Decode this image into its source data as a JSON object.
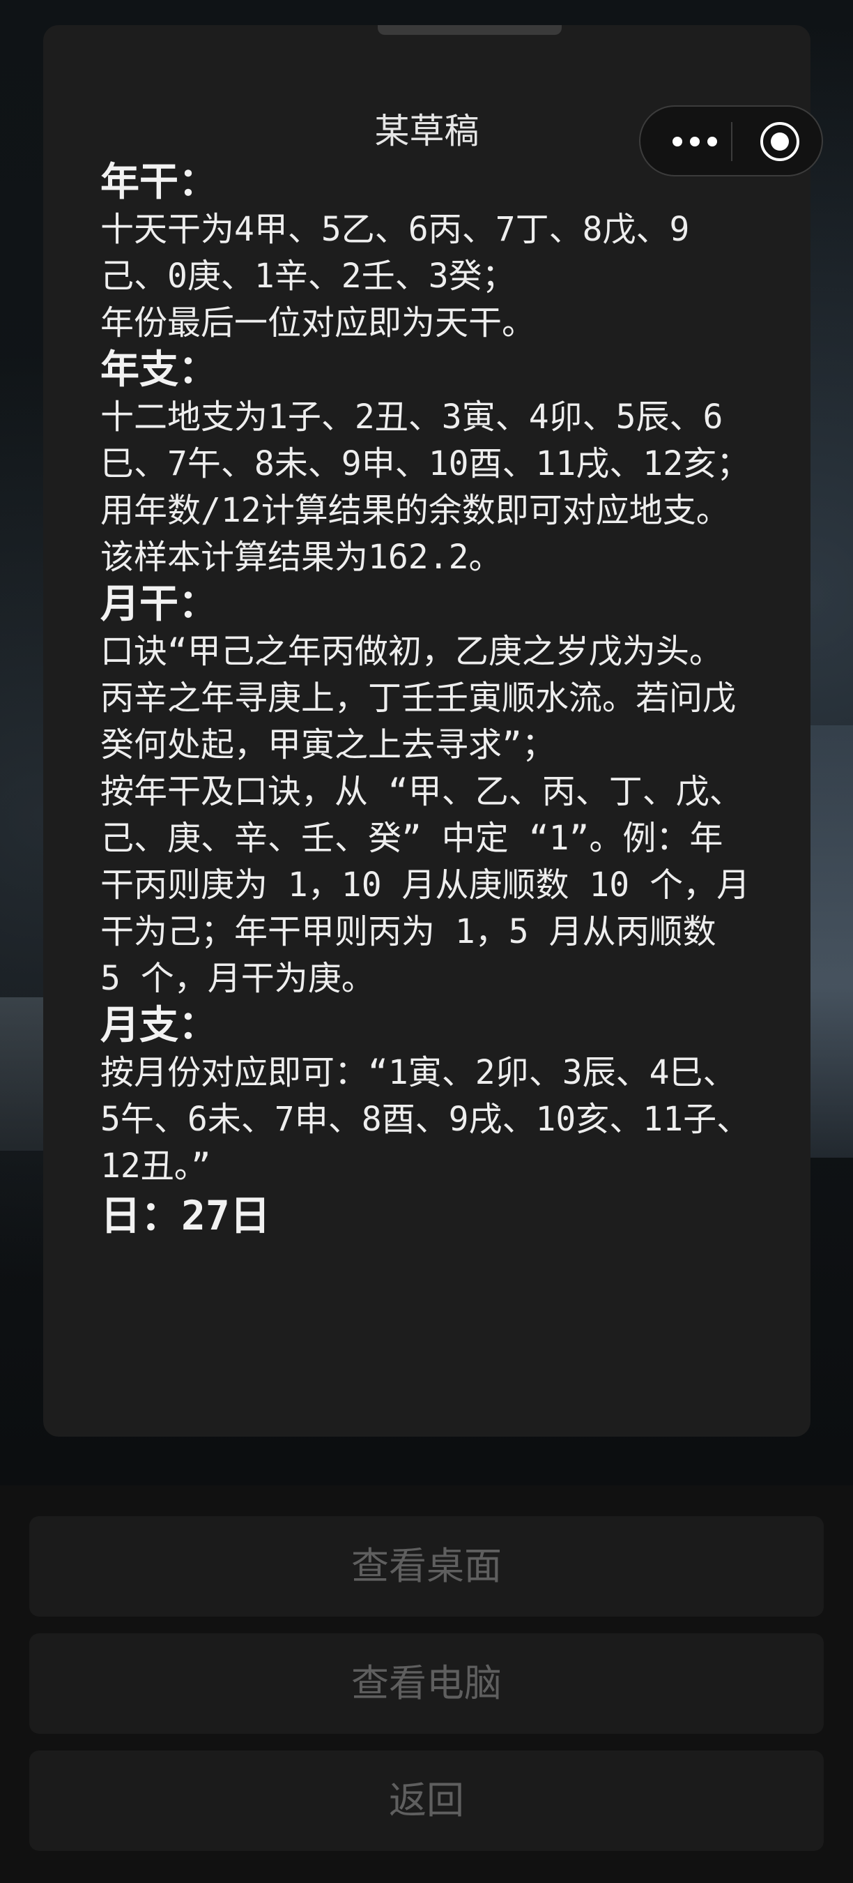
{
  "card": {
    "title": "某草稿",
    "sections": [
      {
        "heading": "年干：",
        "paragraphs": [
          "十天干为4甲、5乙、6丙、7丁、8戊、9己、0庚、1辛、2壬、3癸；",
          "年份最后一位对应即为天干。"
        ]
      },
      {
        "heading": "年支：",
        "paragraphs": [
          "十二地支为1子、2丑、3寅、4卯、5辰、6巳、7午、8未、9申、10酉、11戌、12亥；",
          "用年数/12计算结果的余数即可对应地支。该样本计算结果为162.2。"
        ]
      },
      {
        "heading": "月干：",
        "paragraphs": [
          "口诀“甲己之年丙做初，乙庚之岁戊为头。丙辛之年寻庚上，丁壬壬寅顺水流。若问戊癸何处起，甲寅之上去寻求”；",
          "按年干及口诀，从 “甲、乙、丙、丁、戊、己、庚、辛、壬、癸” 中定 “1”。例：年干丙则庚为 1，10 月从庚顺数 10 个，月干为己；年干甲则丙为 1，5 月从丙顺数 5 个，月干为庚。"
        ]
      },
      {
        "heading": "月支：",
        "paragraphs": [
          "按月份对应即可：“1寅、2卯、3辰、4巳、5午、6未、7申、8酉、9戌、10亥、11子、12丑。”"
        ]
      }
    ],
    "day_line": "日：27日"
  },
  "capsule": {
    "more_icon": "more-dots-icon",
    "close_icon": "target-close-icon"
  },
  "buttons": {
    "view_desktop": "查看桌面",
    "view_computer": "查看电脑",
    "back": "返回"
  }
}
